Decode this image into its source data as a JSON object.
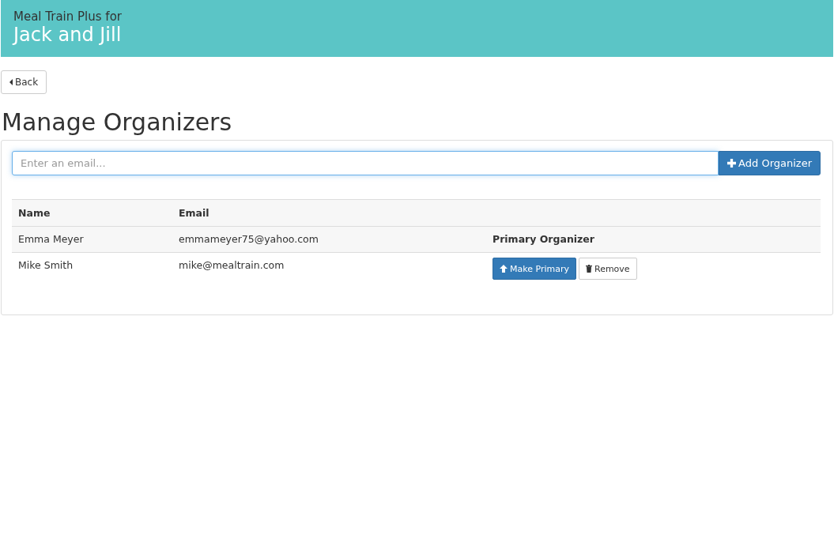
{
  "header": {
    "subtitle": "Meal Train Plus for",
    "title": "Jack and Jill"
  },
  "back_button": {
    "label": "Back"
  },
  "page_title": "Manage Organizers",
  "add_form": {
    "placeholder": "Enter an email...",
    "button": "Add Organizer"
  },
  "table": {
    "columns": [
      "Name",
      "Email"
    ],
    "rows": [
      {
        "name": "Emma Meyer",
        "email": "emmameyer75@yahoo.com",
        "kind": "primary",
        "status": "Primary Organizer"
      },
      {
        "name": "Mike Smith",
        "email": "mike@mealtrain.com",
        "kind": "actions",
        "actions": [
          {
            "kind": "make_primary",
            "label": "Make Primary"
          },
          {
            "kind": "remove",
            "label": "Remove"
          }
        ]
      }
    ]
  }
}
